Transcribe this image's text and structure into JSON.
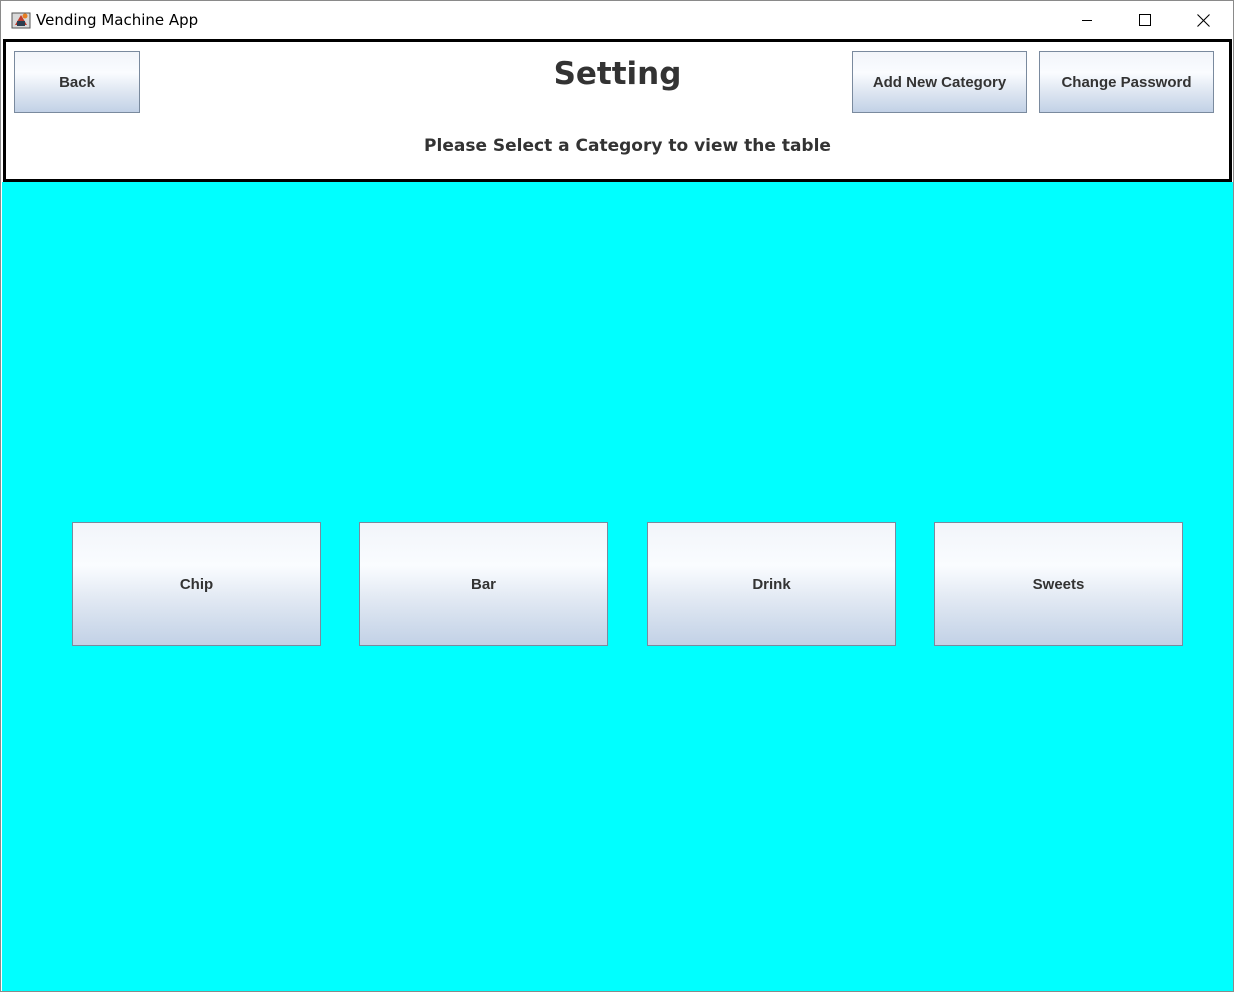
{
  "window": {
    "title": "Vending Machine App",
    "controls": [
      "minimize-icon",
      "maximize-icon",
      "close-icon"
    ]
  },
  "header": {
    "back_label": "Back",
    "title": "Setting",
    "add_category_label": "Add New Category",
    "change_password_label": "Change Password",
    "instruction": "Please Select a Category to view the table"
  },
  "categories": [
    {
      "label": "Chip"
    },
    {
      "label": "Bar"
    },
    {
      "label": "Drink"
    },
    {
      "label": "Sweets"
    }
  ],
  "colors": {
    "main_background": "#00ffff",
    "header_border": "#000000",
    "button_text": "#333333"
  }
}
